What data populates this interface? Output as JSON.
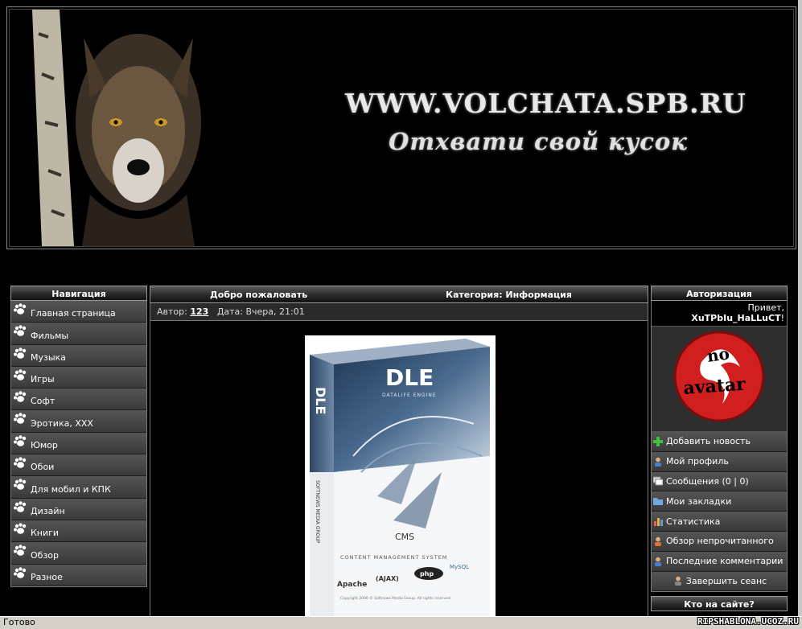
{
  "header": {
    "site_url": "WWW.VOLCHATA.SPB.RU",
    "slogan": "Отхвати свой кусок"
  },
  "nav": {
    "title": "Навигация",
    "items": [
      {
        "label": "Главная страница"
      },
      {
        "label": "Фильмы"
      },
      {
        "label": "Музыка"
      },
      {
        "label": "Игры"
      },
      {
        "label": "Софт"
      },
      {
        "label": "Эротика, XXX"
      },
      {
        "label": "Юмор"
      },
      {
        "label": "Обои"
      },
      {
        "label": "Для мобил и КПК"
      },
      {
        "label": "Дизайн"
      },
      {
        "label": "Книги"
      },
      {
        "label": "Обзор"
      },
      {
        "label": "Разное"
      }
    ]
  },
  "article": {
    "title": "Добро пожаловать",
    "category": "Категория: Информация",
    "author_label": "Автор:",
    "author": "123",
    "date": "Дата: Вчера, 21:01",
    "image": {
      "brand": "DLE",
      "subtitle": "DATALIFE ENGINE",
      "spine": "DLE",
      "spine_sub": "SOFTNEWS MEDIA GROUP",
      "cms": "CMS",
      "cms_full": "CONTENT MANAGEMENT SYSTEM",
      "logos": [
        "Apache",
        "(AJAX)",
        "php",
        "MySQL"
      ],
      "copyright": "Copyright 2006 © Softnews Media Group. All rights reserved"
    }
  },
  "auth": {
    "title": "Авторизация",
    "greeting": "Привет,",
    "username": "XuTPbIu_HaLLuCT",
    "exclaim": "!",
    "avatar_text": [
      "no",
      "avatar"
    ],
    "menu": [
      {
        "label": "Добавить новость",
        "icon": "plus-icon"
      },
      {
        "label": "Мой профиль",
        "icon": "user-icon"
      },
      {
        "label": "Сообщения (0 | 0)",
        "icon": "messages-icon"
      },
      {
        "label": "Мои закладки",
        "icon": "folder-icon"
      },
      {
        "label": "Статистика",
        "icon": "chart-icon"
      },
      {
        "label": "Обзор непрочитанного",
        "icon": "eye-icon"
      },
      {
        "label": "Последние комментарии",
        "icon": "comments-icon"
      },
      {
        "label": "Завершить сеанс",
        "icon": "logout-icon"
      }
    ]
  },
  "who_online": {
    "title": "Кто на сайте?"
  },
  "status_bar": {
    "text": "Готово",
    "watermark": "RIPSHABLONA.UCOZ.RU"
  }
}
